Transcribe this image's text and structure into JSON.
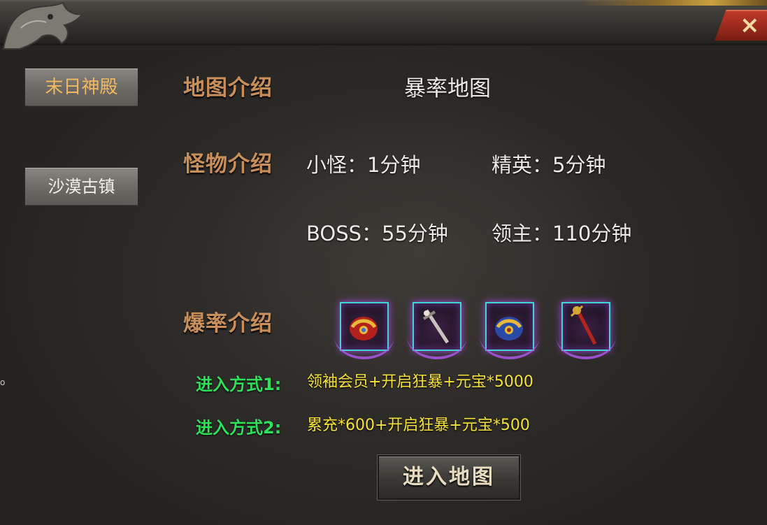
{
  "sidebar": {
    "items": [
      {
        "label": "末日神殿",
        "active": true
      },
      {
        "label": "沙漠古镇",
        "active": false
      }
    ]
  },
  "map_intro": {
    "label": "地图介绍",
    "value": "暴率地图"
  },
  "monster_intro": {
    "label": "怪物介绍",
    "entries": [
      {
        "text": "小怪：1分钟"
      },
      {
        "text": "精英：5分钟"
      },
      {
        "text": "BOSS：55分钟"
      },
      {
        "text": "领主：110分钟"
      }
    ]
  },
  "drop_intro": {
    "label": "爆率介绍",
    "items": [
      {
        "icon": "red-gold-armor-icon"
      },
      {
        "icon": "silver-sword-icon"
      },
      {
        "icon": "blue-gold-armor-icon"
      },
      {
        "icon": "red-staff-icon"
      }
    ]
  },
  "entry_methods": [
    {
      "label": "进入方式1:",
      "value": "领袖会员+开启狂暴+元宝*5000"
    },
    {
      "label": "进入方式2:",
      "value": "累充*600+开启狂暴+元宝*500"
    }
  ],
  "enter_button": {
    "label": "进入地图"
  },
  "close_button": {
    "label": "×"
  },
  "edge_mark": "o",
  "colors": {
    "section_label": "#c98f5a",
    "active_tab_text": "#f0b860",
    "entry_label": "#2fe05a",
    "entry_value": "#f5e23a",
    "slot_border": "#3fd6d6",
    "close_button": "#c0392b"
  }
}
